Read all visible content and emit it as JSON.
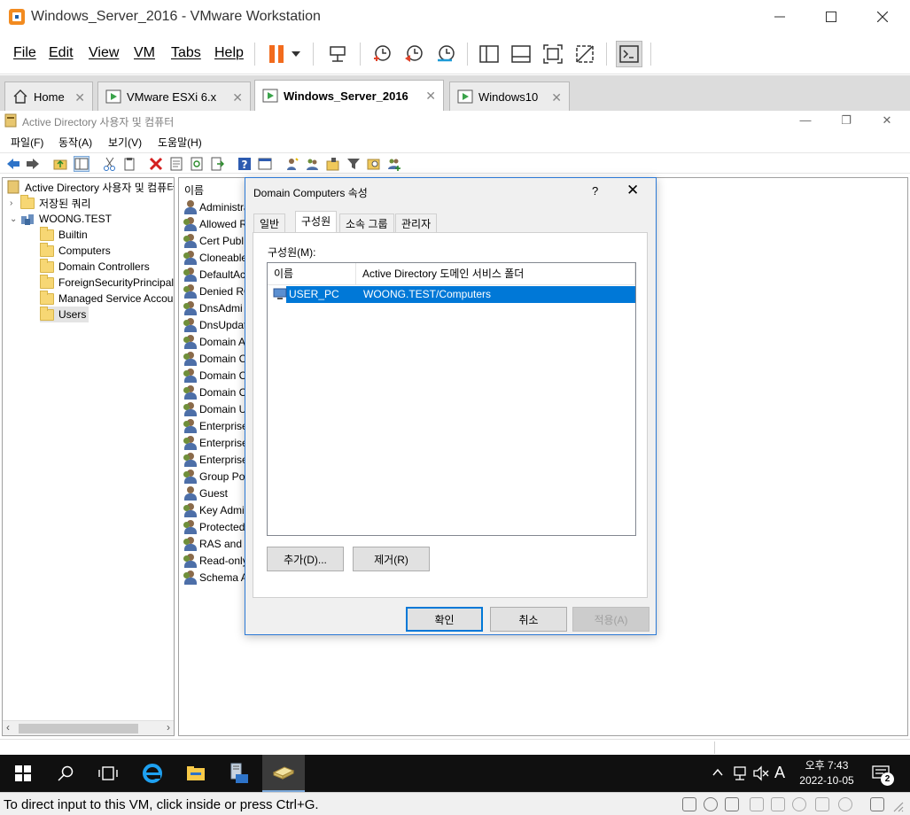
{
  "window": {
    "title": "Windows_Server_2016 - VMware Workstation"
  },
  "menu": {
    "file": "File",
    "edit": "Edit",
    "view": "View",
    "vm": "VM",
    "tabs": "Tabs",
    "help": "Help"
  },
  "tabs": [
    {
      "label": "Home"
    },
    {
      "label": "VMware ESXi 6.x"
    },
    {
      "label": "Windows_Server_2016"
    },
    {
      "label": "Windows10"
    }
  ],
  "ad": {
    "title": "Active Directory 사용자 및 컴퓨터",
    "menu": [
      "파일(F)",
      "동작(A)",
      "보기(V)",
      "도움말(H)"
    ]
  },
  "tree": {
    "root": "Active Directory 사용자 및 컴퓨터",
    "items": [
      {
        "label": "저장된 쿼리"
      },
      {
        "label": "WOONG.TEST"
      },
      {
        "label": "Builtin"
      },
      {
        "label": "Computers"
      },
      {
        "label": "Domain Controllers"
      },
      {
        "label": "ForeignSecurityPrincipals"
      },
      {
        "label": "Managed Service Accounts"
      },
      {
        "label": "Users"
      }
    ]
  },
  "list": {
    "header": "이름",
    "items": [
      "Administrat",
      "Allowed R",
      "Cert Publ",
      "Cloneable",
      "DefaultAc",
      "Denied RO",
      "DnsAdmi",
      "DnsUpdat",
      "Domain A",
      "Domain C",
      "Domain C",
      "Domain C",
      "Domain U",
      "Enterprise",
      "Enterprise",
      "Enterprise",
      "Group Po",
      "Guest",
      "Key Admi",
      "Protected",
      "RAS and",
      "Read-only",
      "Schema A"
    ]
  },
  "dialog": {
    "title": "Domain Computers 속성",
    "help": "?",
    "tabs": [
      "일반",
      "구성원",
      "소속 그룹",
      "관리자"
    ],
    "members_label": "구성원(M):",
    "columns": [
      "이름",
      "Active Directory 도메인 서비스 폴더"
    ],
    "members": [
      {
        "name": "USER_PC",
        "folder": "WOONG.TEST/Computers"
      }
    ],
    "add_button": "추가(D)...",
    "remove_button": "제거(R)",
    "ok_button": "확인",
    "cancel_button": "취소",
    "apply_button": "적용(A)"
  },
  "taskbar": {
    "time": "오후 7:43",
    "date": "2022-10-05",
    "ime": "A",
    "notifications": "2"
  },
  "status": {
    "message": "To direct input to this VM, click inside or press Ctrl+G."
  },
  "colors": {
    "accent": "#0078d7",
    "pause": "#f26b1d",
    "dialog_border": "#2b79d6"
  }
}
